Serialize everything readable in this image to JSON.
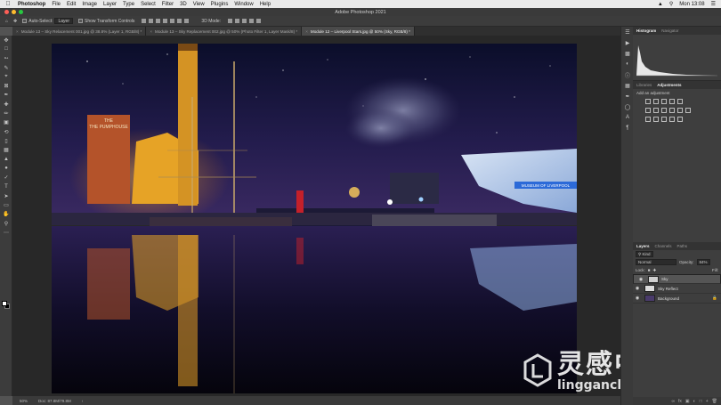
{
  "menubar": {
    "app": "Photoshop",
    "items": [
      "File",
      "Edit",
      "Image",
      "Layer",
      "Type",
      "Select",
      "Filter",
      "3D",
      "View",
      "Plugins",
      "Window",
      "Help"
    ],
    "clock": "Mon 13:08"
  },
  "window": {
    "title": "Adobe Photoshop 2021"
  },
  "options": {
    "auto_select": "Auto-Select:",
    "auto_select_value": "Layer",
    "show_transform": "Show Transform Controls",
    "mode_3d": "3D Mode:"
  },
  "tabs": [
    {
      "label": "Module 13 – Sky Relacement 001.jpg @ 38.8% (Layer 1, RGB/8) *",
      "active": false
    },
    {
      "label": "Module 13 – Sky Replacement 002.jpg @ 50% (Photo Filter 1, Layer Mask/8) *",
      "active": false
    },
    {
      "label": "Module 12 – Liverpool Stars.jpg @ 50% (Sky, RGB/8) *",
      "active": true
    }
  ],
  "status": {
    "zoom": "50%",
    "doc": "Doc: 87.8M/79.8M"
  },
  "panels": {
    "histogram_tab": "Histogram",
    "navigator_tab": "Navigator",
    "libraries_tab": "Libraries",
    "adjustments_tab": "Adjustments",
    "add_adjustment": "Add an adjustment",
    "layers_tab": "Layers",
    "channels_tab": "Channels",
    "paths_tab": "Paths",
    "kind": "Kind",
    "blend_mode": "Normal",
    "opacity_label": "Opacity:",
    "opacity_value": "84%",
    "lock_label": "Lock:",
    "fill_label": "Fill:"
  },
  "layers": [
    {
      "name": "Sky",
      "selected": true,
      "thumb": "#cfcfcf"
    },
    {
      "name": "Sky Reflect",
      "selected": false,
      "thumb": "#dcdcdc"
    },
    {
      "name": "Background",
      "selected": false,
      "thumb": "#4a3b6b"
    }
  ],
  "photo": {
    "sign_text": "THE PUMPHOUSE",
    "museum_text": "MUSEUM OF LIVERPOOL"
  },
  "watermark": {
    "cn": "灵感中国",
    "en": "lingganchina.com"
  },
  "icons": [
    "apple-icon",
    "move-tool-icon",
    "eye-icon",
    "lock-icon",
    "histogram-icon"
  ]
}
